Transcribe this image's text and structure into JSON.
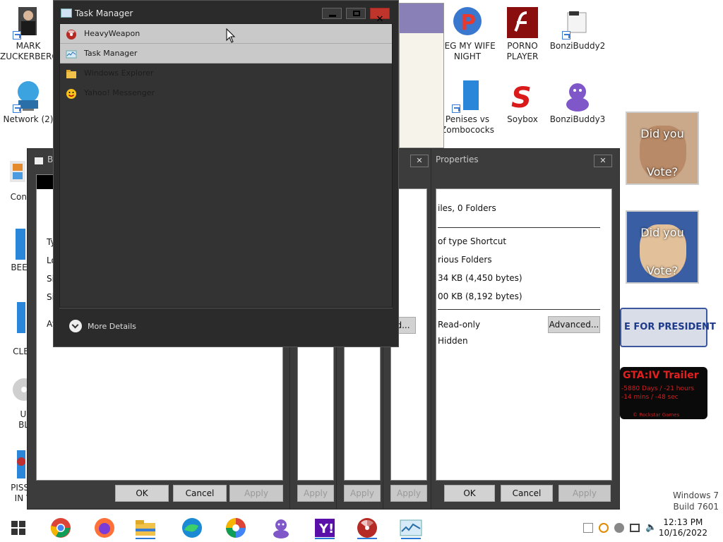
{
  "desktop_icons": [
    {
      "label": "MARK ZUCKERBERG"
    },
    {
      "label": "Network (2)"
    },
    {
      "label": "Control Panel"
    },
    {
      "label": "BEEP BEEP"
    },
    {
      "label": "COMPUTER CLEANER"
    },
    {
      "label": "ULTRA BLOAT"
    },
    {
      "label": "PISSED IN VIDEO"
    },
    {
      "label": "PEG MY WIFE NIGHT"
    },
    {
      "label": "PORNO PLAYER"
    },
    {
      "label": "BonziBuddy2"
    },
    {
      "label": "Penises vs Zombococks"
    },
    {
      "label": "Soybox"
    },
    {
      "label": "BonziBuddy3"
    }
  ],
  "task_manager": {
    "title": "Task Manager",
    "processes": [
      {
        "name": "HeavyWeapon"
      },
      {
        "name": "Task Manager"
      },
      {
        "name": "Windows Explorer"
      },
      {
        "name": "Yahoo! Messenger"
      }
    ],
    "more_details": "More Details"
  },
  "properties_window": {
    "title": "Properties",
    "close": "✕",
    "files_line": "iles, 0 Folders",
    "type_line": "of type Shortcut",
    "location_line": "rious Folders",
    "size_line": "34 KB (4,450 bytes)",
    "size_on_disk_line": "00 KB (8,192 bytes)",
    "readonly": "Read-only",
    "hidden": "Hidden",
    "advanced": "Advanced...",
    "ok": "OK",
    "cancel": "Cancel",
    "apply": "Apply"
  },
  "left_window": {
    "title": "B",
    "labels": [
      "Ty",
      "Lo",
      "Siz",
      "Siz",
      "At"
    ],
    "ok": "OK",
    "cancel": "Cancel",
    "apply": "Apply"
  },
  "middle_windows": {
    "apply_labels": [
      "Apply",
      "Apply",
      "Apply"
    ],
    "advanced_stub": "d..."
  },
  "posters": [
    {
      "top": "Did you",
      "bottom": "Vote?"
    },
    {
      "top": "Did you",
      "bottom": "Vote?"
    }
  ],
  "banners": {
    "president": "E FOR PRESIDENT",
    "gta_title": "GTA:IV Trailer",
    "gta_line1": "-5880 Days / -21 hours",
    "gta_line2": "-14 mins / -48 sec",
    "gta_footer": "© Rockstar Games"
  },
  "watermark": {
    "line1": "Windows 7",
    "line2": "Build 7601"
  },
  "clock": {
    "time": "12:13 PM",
    "date": "10/16/2022"
  },
  "taskbar_apps": [
    "start",
    "chrome",
    "firefox",
    "explorer",
    "edge",
    "pinwheel",
    "bonzi",
    "yahoo",
    "heavyweapon",
    "taskmanager"
  ]
}
